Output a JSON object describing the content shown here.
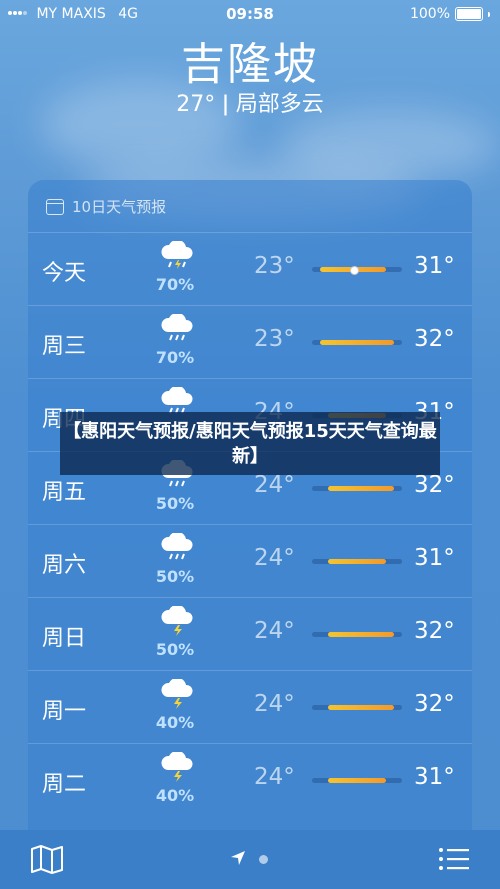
{
  "status": {
    "carrier": "MY MAXIS",
    "network": "4G",
    "time": "09:58",
    "battery": "100%"
  },
  "location": {
    "city": "吉隆坡",
    "summary": "27° ǀ 局部多云"
  },
  "forecast": {
    "header_icon": "calendar-icon",
    "title": "10日天气预报",
    "days": [
      {
        "day": "今天",
        "icon": "thunderstorm-rain-icon",
        "precip": "70%",
        "low": "23°",
        "high": "31°",
        "current": true
      },
      {
        "day": "周三",
        "icon": "rain-icon",
        "precip": "70%",
        "low": "23°",
        "high": "32°"
      },
      {
        "day": "周四",
        "icon": "rain-icon",
        "precip": "",
        "low": "24°",
        "high": "31°"
      },
      {
        "day": "周五",
        "icon": "rain-icon",
        "precip": "50%",
        "low": "24°",
        "high": "32°"
      },
      {
        "day": "周六",
        "icon": "rain-icon",
        "precip": "50%",
        "low": "24°",
        "high": "31°"
      },
      {
        "day": "周日",
        "icon": "thunderstorm-icon",
        "precip": "50%",
        "low": "24°",
        "high": "32°"
      },
      {
        "day": "周一",
        "icon": "thunderstorm-icon",
        "precip": "40%",
        "low": "24°",
        "high": "32°"
      },
      {
        "day": "周二",
        "icon": "thunderstorm-icon",
        "precip": "40%",
        "low": "24°",
        "high": "31°"
      }
    ]
  },
  "overlay_banner": "【惠阳天气预报/惠阳天气预报15天天气查询最新】",
  "toolbar": {
    "map": "map-icon",
    "location": "location-arrow-icon",
    "list": "list-icon"
  },
  "colors": {
    "bar_start": "#f4c430",
    "bar_end": "#f39a2a",
    "precip_text": "#bfe0ff"
  }
}
